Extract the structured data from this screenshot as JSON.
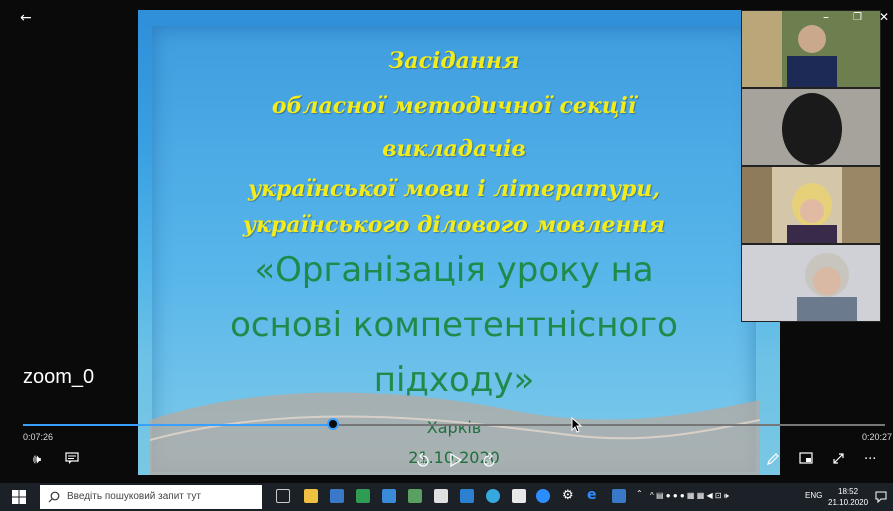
{
  "window": {
    "back_glyph": "←",
    "minimize_glyph": "–",
    "maximize_glyph": "❐",
    "close_glyph": "✕"
  },
  "slide": {
    "heading_lines": [
      "Засідання",
      "обласної методичної секції",
      "викладачів",
      "української мови і літератури,",
      "українського ділового мовлення"
    ],
    "topic_lines": [
      "«Організація уроку на",
      "основі компетентнісного",
      "підходу»"
    ],
    "city": "Харків",
    "date": "21.10.2020",
    "heading_color": "#f4ec1a",
    "topic_color": "#1f8a4a"
  },
  "player": {
    "video_title": "zoom_0",
    "current_time": "0:07:26",
    "total_time": "0:20:27",
    "progress_fraction": 0.36,
    "skip_back_label": "10",
    "skip_forward_label": "30",
    "accent_color": "#3aa0ff",
    "icons": [
      "volume-icon",
      "subtitles-icon",
      "skip-back-icon",
      "play-icon",
      "skip-forward-icon",
      "pen-icon",
      "miniplayer-icon",
      "fullscreen-icon",
      "more-icon"
    ]
  },
  "taskbar": {
    "search_placeholder": "Введіть пошуковий запит тут",
    "tray_lang": "ENG",
    "clock_time": "18:52",
    "clock_date": "21.10.2020"
  }
}
